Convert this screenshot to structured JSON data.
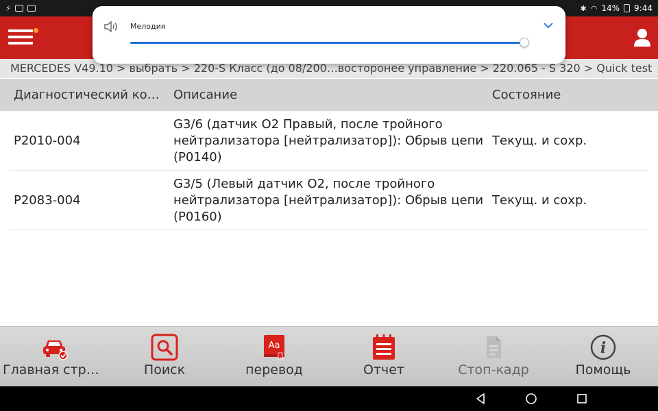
{
  "statusbar": {
    "left_icons": [
      "usb-icon",
      "image-icon",
      "sd-icon"
    ],
    "battery": "14%",
    "time": "9:44"
  },
  "volume": {
    "label": "Мелодия",
    "level": 1.0
  },
  "breadcrumb": "MERCEDES V49.10 > выбрать > 220-S Класс (до 08/200…восторонее управление > 220.065 - S 320 > Quick test",
  "table": {
    "headers": {
      "code": "Диагностический код…",
      "description": "Описание",
      "state": "Состояние"
    },
    "rows": [
      {
        "code": "P2010-004",
        "description": "G3/6 (датчик O2 Правый, после тройного нейтрализатора [нейтрализатор]): Обрыв цепи (P0140)",
        "state": "Текущ. и сохр."
      },
      {
        "code": "P2083-004",
        "description": "G3/5 (Левый датчик O2, после тройного нейтрализатора [нейтрализатор]): Обрыв цепи (P0160)",
        "state": "Текущ. и сохр."
      }
    ]
  },
  "toolbar": {
    "home": "Главная стран…",
    "search": "Поиск",
    "translate": "перевод",
    "report": "Отчет",
    "freeze_frame": "Стоп-кадр",
    "help": "Помощь"
  },
  "colors": {
    "header_red": "#c8201c",
    "icon_red": "#d9221c",
    "accent_blue": "#1e6fd9"
  }
}
